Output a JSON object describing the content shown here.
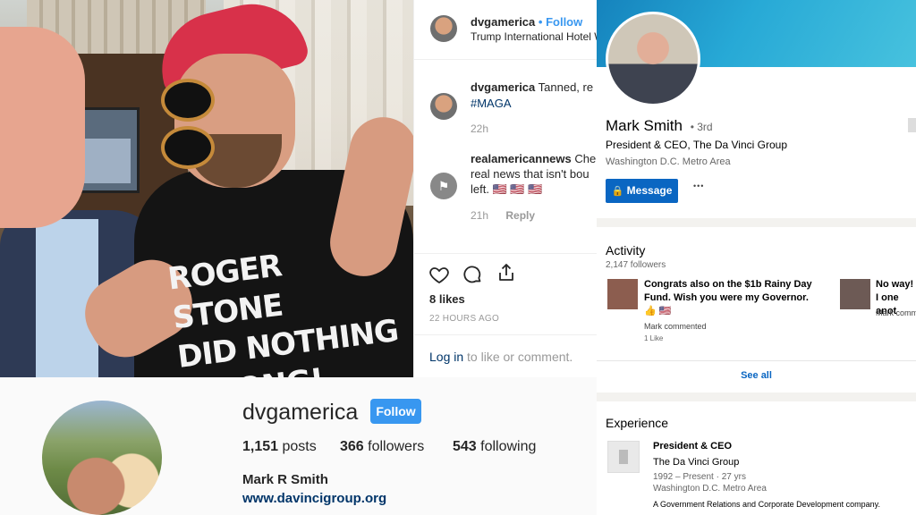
{
  "instagram_post": {
    "photo_shirt_text": [
      "ROGER STONE",
      "DID NOTHING",
      "WRONG!"
    ],
    "header": {
      "username": "dvgamerica",
      "separator": "•",
      "follow": "Follow",
      "location": "Trump International Hotel W"
    },
    "comments": [
      {
        "username": "dvgamerica",
        "text": "Tanned, re",
        "hashtag": "#MAGA",
        "time": "22h"
      },
      {
        "username": "realamericannews",
        "text_line1": "Che",
        "text_line2": "real news that isn't bou",
        "text_line3": "left. 🇺🇸 🇺🇸 🇺🇸",
        "time": "21h",
        "reply": "Reply"
      }
    ],
    "likes": "8 likes",
    "timestamp": "22 HOURS AGO",
    "login_prompt": {
      "link": "Log in",
      "text": " to like or comment."
    }
  },
  "instagram_profile": {
    "username": "dvgamerica",
    "follow": "Follow",
    "posts_count": "1,151",
    "posts_label": " posts",
    "followers_count": "366",
    "followers_label": " followers",
    "following_count": "543",
    "following_label": " following",
    "full_name": "Mark R Smith",
    "website": "www.davincigroup.org"
  },
  "linkedin": {
    "name": "Mark Smith",
    "degree": "• 3rd",
    "headline": "President & CEO, The Da Vinci Group",
    "location": "Washington D.C. Metro Area",
    "message_button": "Message",
    "more": "•••",
    "activity": {
      "title": "Activity",
      "followers": "2,147 followers",
      "items": [
        {
          "text": "Congrats also on the $1b Rainy Day Fund. Wish you were my Governor. 👍 🇺🇸",
          "meta": "Mark commented",
          "reactions": "1 Like"
        },
        {
          "text": "No way! I one anot",
          "meta": "Mark comm"
        }
      ],
      "see_all": "See all"
    },
    "experience": {
      "title": "Experience",
      "role": "President & CEO",
      "company": "The Da Vinci Group",
      "dates": "1992 – Present · 27 yrs",
      "location": "Washington D.C. Metro Area",
      "description": "A Government Relations and Corporate Development company."
    }
  }
}
